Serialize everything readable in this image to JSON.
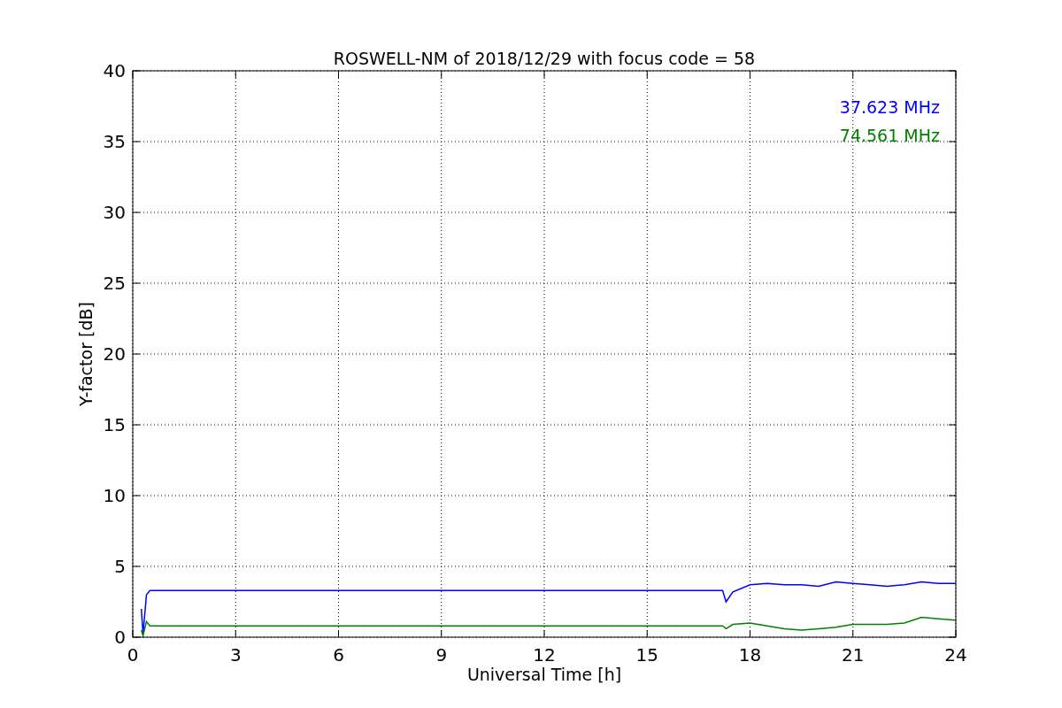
{
  "figure": {
    "chart_data": {
      "type": "line",
      "title": "ROSWELL-NM of 2018/12/29 with focus code = 58",
      "xlabel": "Universal Time [h]",
      "ylabel": "Y-factor [dB]",
      "x": [
        0.25,
        0.3,
        0.4,
        0.5,
        3,
        6,
        9,
        12,
        15,
        17.2,
        17.3,
        17.5,
        18,
        18.5,
        19,
        19.5,
        20,
        20.5,
        21,
        21.5,
        22,
        22.5,
        23,
        23.5,
        24
      ],
      "series": [
        {
          "name": "37.623 MHz",
          "color": "#0000ff",
          "values": [
            2.0,
            0.2,
            3.0,
            3.3,
            3.3,
            3.3,
            3.3,
            3.3,
            3.3,
            3.3,
            2.5,
            3.2,
            3.7,
            3.8,
            3.7,
            3.7,
            3.6,
            3.9,
            3.8,
            3.7,
            3.6,
            3.7,
            3.9,
            3.8,
            3.8
          ]
        },
        {
          "name": "74.561 MHz",
          "color": "#008000",
          "values": [
            0.5,
            0.1,
            1.1,
            0.8,
            0.8,
            0.8,
            0.8,
            0.8,
            0.8,
            0.8,
            0.6,
            0.9,
            1.0,
            0.8,
            0.6,
            0.5,
            0.6,
            0.7,
            0.9,
            0.9,
            0.9,
            1.0,
            1.4,
            1.3,
            1.2
          ]
        }
      ],
      "xlim": [
        0,
        24
      ],
      "ylim": [
        0,
        40
      ],
      "xticks": [
        0,
        3,
        6,
        9,
        12,
        15,
        18,
        21,
        24
      ],
      "yticks": [
        0,
        5,
        10,
        15,
        20,
        25,
        30,
        35,
        40
      ],
      "grid": true
    }
  }
}
